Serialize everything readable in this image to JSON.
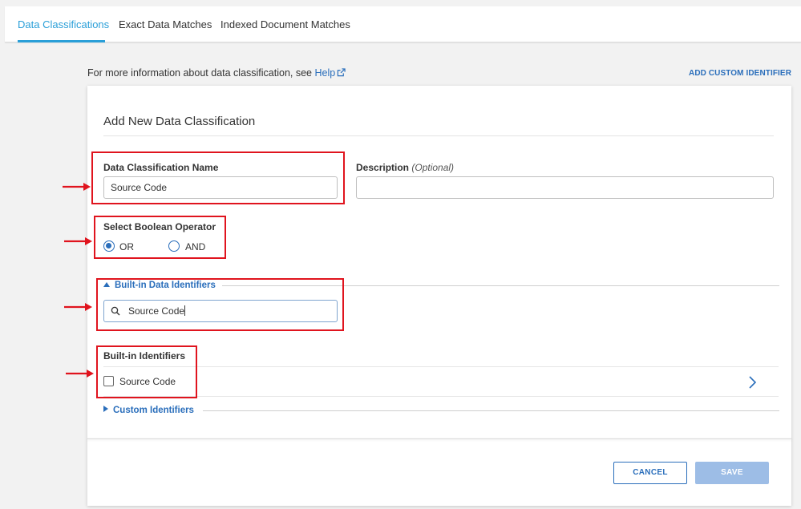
{
  "tabs": [
    {
      "label": "Data Classifications",
      "active": true
    },
    {
      "label": "Exact Data Matches",
      "active": false
    },
    {
      "label": "Indexed Document Matches",
      "active": false
    }
  ],
  "info": {
    "text": "For more information about data classification, see ",
    "help_link": "Help",
    "add_custom_identifier": "ADD CUSTOM IDENTIFIER"
  },
  "form": {
    "title": "Add New Data Classification",
    "name_label": "Data Classification Name",
    "name_value": "Source Code",
    "description_label": "Description",
    "description_optional": "(Optional)",
    "description_value": "",
    "boolean_label": "Select Boolean Operator",
    "boolean_options": [
      {
        "label": "OR",
        "selected": true
      },
      {
        "label": "AND",
        "selected": false
      }
    ],
    "builtin_section": "Built-in Data Identifiers",
    "search_value": "Source Code",
    "builtin_identifiers_label": "Built-in Identifiers",
    "identifier_item": {
      "label": "Source Code",
      "checked": false
    },
    "custom_section": "Custom Identifiers"
  },
  "footer": {
    "cancel": "CANCEL",
    "save": "SAVE"
  },
  "colors": {
    "accent": "#2a6ebb",
    "tab_active": "#2a9fd8",
    "annotation": "#e0141e",
    "save_disabled": "#9dbde6"
  }
}
